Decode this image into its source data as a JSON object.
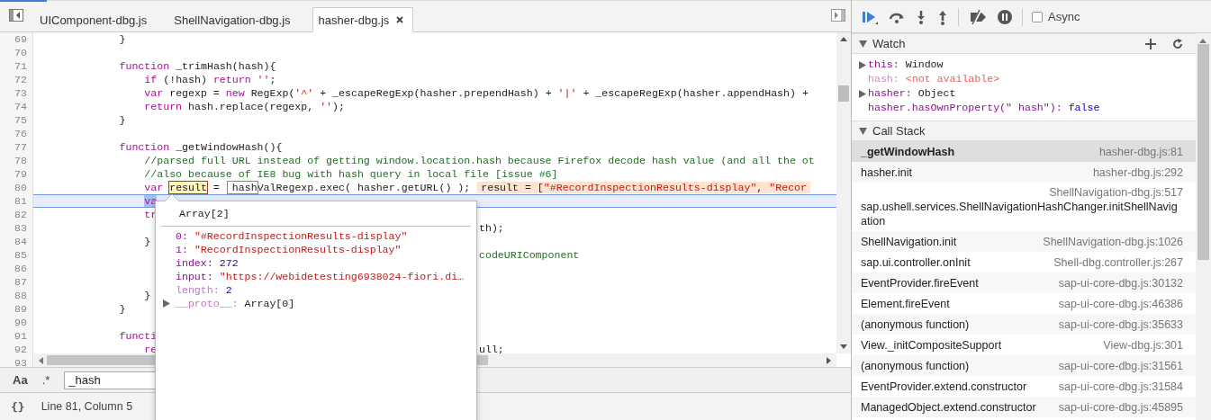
{
  "tabs": [
    {
      "label": "UIComponent-dbg.js",
      "selected": false,
      "closable": false
    },
    {
      "label": "ShellNavigation-dbg.js",
      "selected": false,
      "closable": false
    },
    {
      "label": "hasher-dbg.js",
      "selected": true,
      "closable": true
    }
  ],
  "editor": {
    "lines": [
      {
        "number": "69",
        "current": false,
        "tokens": [
          {
            "kind": "plain",
            "text": "            }"
          }
        ]
      },
      {
        "number": "70",
        "current": false
      },
      {
        "number": "71",
        "current": false,
        "tokens": [
          {
            "kind": "keyword",
            "text": "            function"
          },
          {
            "kind": "plain",
            "text": " _trimHash(hash){"
          }
        ]
      },
      {
        "number": "72",
        "current": false,
        "tokens": [
          {
            "kind": "keyword",
            "text": "                if"
          },
          {
            "kind": "plain",
            "text": " (!hash) "
          },
          {
            "kind": "keyword",
            "text": "return"
          },
          {
            "kind": "string",
            "text": " ''"
          },
          {
            "kind": "plain",
            "text": ";"
          }
        ]
      },
      {
        "number": "73",
        "current": false,
        "tokens": [
          {
            "kind": "keyword",
            "text": "                var"
          },
          {
            "kind": "plain",
            "text": " regexp = "
          },
          {
            "kind": "keyword",
            "text": "new"
          },
          {
            "kind": "plain",
            "text": " RegExp("
          },
          {
            "kind": "string",
            "text": "'^'"
          },
          {
            "kind": "plain",
            "text": " + _escapeRegExp(hasher.prependHash) + "
          },
          {
            "kind": "string",
            "text": "'|'"
          },
          {
            "kind": "plain",
            "text": " + _escapeRegExp(hasher.appendHash) +"
          }
        ]
      },
      {
        "number": "74",
        "current": false,
        "tokens": [
          {
            "kind": "keyword",
            "text": "                return"
          },
          {
            "kind": "plain",
            "text": " hash.replace(regexp, "
          },
          {
            "kind": "string",
            "text": "''"
          },
          {
            "kind": "plain",
            "text": ");"
          }
        ]
      },
      {
        "number": "75",
        "current": false,
        "tokens": [
          {
            "kind": "plain",
            "text": "            }"
          }
        ]
      },
      {
        "number": "76",
        "current": false
      },
      {
        "number": "77",
        "current": false,
        "tokens": [
          {
            "kind": "keyword",
            "text": "            function"
          },
          {
            "kind": "plain",
            "text": " _getWindowHash(){"
          }
        ]
      },
      {
        "number": "78",
        "current": false,
        "tokens": [
          {
            "kind": "comment",
            "text": "                //parsed full URL instead of getting window.location.hash because Firefox decode hash value (and all the ot"
          }
        ]
      },
      {
        "number": "79",
        "current": false,
        "tokens": [
          {
            "kind": "comment",
            "text": "                //also because of IE8 bug with hash query in local file [issue #6]"
          }
        ]
      },
      {
        "number": "80",
        "current": false,
        "tokens": [
          {
            "kind": "keyword",
            "text": "                var "
          },
          {
            "kind": "hovered",
            "text": "result"
          },
          {
            "kind": "plain",
            "text": " = "
          },
          {
            "kind": "boxed",
            "text": "hash"
          },
          {
            "kind": "plain",
            "text": "ValRegexp.exec( hasher.getURL() );"
          }
        ],
        "inline_value": [
          {
            "kind": "plain",
            "text": "result = ["
          },
          {
            "kind": "string",
            "text": "\"#RecordInspectionResults-display\""
          },
          {
            "kind": "plain",
            "text": ", "
          },
          {
            "kind": "string",
            "text": "\"Recor"
          }
        ]
      },
      {
        "number": "81",
        "current": true,
        "tokens": [
          {
            "kind": "selected",
            "text": "                va"
          }
        ]
      },
      {
        "number": "82",
        "current": false,
        "tokens": [
          {
            "kind": "keyword",
            "text": "                tr"
          }
        ]
      },
      {
        "number": "83",
        "current": false,
        "tail": [
          {
            "kind": "plain",
            "text": "th);"
          }
        ]
      },
      {
        "number": "84",
        "current": false,
        "tokens": [
          {
            "kind": "plain",
            "text": "                }"
          }
        ]
      },
      {
        "number": "85",
        "current": false,
        "tail": [
          {
            "kind": "comment",
            "text": "codeURIComponent"
          }
        ]
      },
      {
        "number": "86",
        "current": false
      },
      {
        "number": "87",
        "current": false
      },
      {
        "number": "88",
        "current": false,
        "tokens": [
          {
            "kind": "plain",
            "text": "                }"
          }
        ]
      },
      {
        "number": "89",
        "current": false,
        "tokens": [
          {
            "kind": "plain",
            "text": "            }"
          }
        ]
      },
      {
        "number": "90",
        "current": false
      },
      {
        "number": "91",
        "current": false,
        "tokens": [
          {
            "kind": "keyword",
            "text": "            functi"
          }
        ]
      },
      {
        "number": "92",
        "current": false,
        "tokens": [
          {
            "kind": "keyword",
            "text": "                re"
          }
        ],
        "tail": [
          {
            "kind": "plain",
            "text": "ull;"
          }
        ]
      },
      {
        "number": "93",
        "current": false
      }
    ],
    "popup": {
      "title": "Array[2]",
      "properties": [
        {
          "key": "0:",
          "value": "\"#RecordInspectionResults-display\"",
          "kind": "string",
          "enumerable": true,
          "expandable": false
        },
        {
          "key": "1:",
          "value": "\"RecordInspectionResults-display\"",
          "kind": "string",
          "enumerable": true,
          "expandable": false
        },
        {
          "key": "index:",
          "value": "272",
          "kind": "number",
          "enumerable": true,
          "expandable": false
        },
        {
          "key": "input:",
          "value": "\"https://webidetesting6938024-fiori.di…",
          "kind": "string",
          "enumerable": true,
          "expandable": false
        },
        {
          "key": "length:",
          "value": "2",
          "kind": "number",
          "enumerable": false,
          "expandable": false
        },
        {
          "key": "__proto__:",
          "value": "Array[0]",
          "kind": "object",
          "enumerable": false,
          "expandable": true
        }
      ]
    }
  },
  "search": {
    "case_label": "Aa",
    "regex_label": ".*",
    "value": "_hash"
  },
  "status": {
    "format_label": "{}",
    "position": "Line 81, Column 5"
  },
  "debugger": {
    "async": {
      "label": "Async",
      "checked": false
    },
    "watch": {
      "title": "Watch",
      "items": [
        {
          "name": "this:",
          "value": "Window",
          "kind": "object",
          "expandable": true
        },
        {
          "name": "hash:",
          "value": "<not available>",
          "kind": "unavailable",
          "expandable": false
        },
        {
          "name": "hasher:",
          "value": "Object",
          "kind": "object",
          "expandable": true
        },
        {
          "name": "hasher.hasOwnProperty(\" hash\"):",
          "value": "false",
          "kind": "keyword",
          "expandable": false
        }
      ]
    },
    "call_stack": {
      "title": "Call Stack",
      "frames": [
        {
          "function": "_getWindowHash",
          "location": "hasher-dbg.js:81",
          "selected": true
        },
        {
          "function": "hasher.init",
          "location": "hasher-dbg.js:292",
          "selected": false
        },
        {
          "function": "sap.ushell.services.ShellNavigationHashChanger.initShellNavigation",
          "location": "ShellNavigation-dbg.js:517",
          "selected": false
        },
        {
          "function": "ShellNavigation.init",
          "location": "ShellNavigation-dbg.js:1026",
          "selected": false
        },
        {
          "function": "sap.ui.controller.onInit",
          "location": "Shell-dbg.controller.js:267",
          "selected": false
        },
        {
          "function": "EventProvider.fireEvent",
          "location": "sap-ui-core-dbg.js:30132",
          "selected": false
        },
        {
          "function": "Element.fireEvent",
          "location": "sap-ui-core-dbg.js:46386",
          "selected": false
        },
        {
          "function": "(anonymous function)",
          "location": "sap-ui-core-dbg.js:35633",
          "selected": false
        },
        {
          "function": "View._initCompositeSupport",
          "location": "View-dbg.js:301",
          "selected": false
        },
        {
          "function": "(anonymous function)",
          "location": "sap-ui-core-dbg.js:31561",
          "selected": false
        },
        {
          "function": "EventProvider.extend.constructor",
          "location": "sap-ui-core-dbg.js:31584",
          "selected": false
        },
        {
          "function": "ManagedObject.extend.constructor",
          "location": "sap-ui-core-dbg.js:45895",
          "selected": false
        }
      ]
    }
  }
}
